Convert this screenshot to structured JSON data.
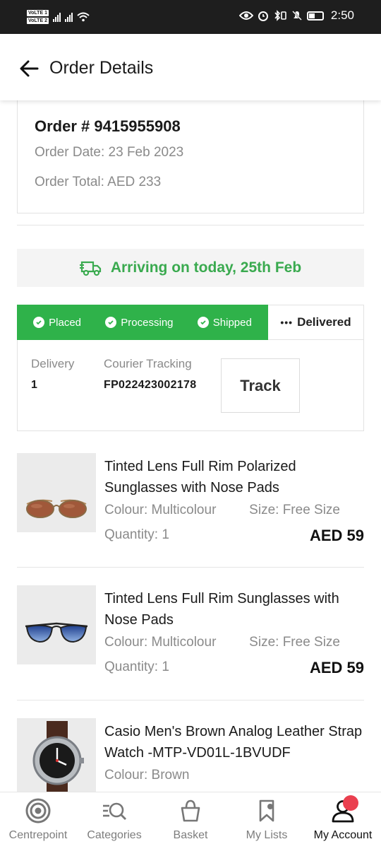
{
  "status_bar": {
    "volte1": "VoLTE 1",
    "volte2": "VoLTE 2",
    "time": "2:50"
  },
  "header": {
    "title": "Order Details"
  },
  "order": {
    "number": "Order # 9415955908",
    "date": "Order Date: 23 Feb 2023",
    "total": "Order Total: AED 233"
  },
  "arrival": {
    "text": "Arriving on today, 25th Feb",
    "color": "#3aaa4f"
  },
  "status_track": {
    "steps_done": [
      "Placed",
      "Processing",
      "Shipped"
    ],
    "step_pending": "Delivered",
    "done_color": "#2fb24a"
  },
  "delivery": {
    "label": "Delivery",
    "value": "1",
    "courier_label": "Courier Tracking",
    "courier_value": "FP022423002178",
    "track_label": "Track"
  },
  "products": [
    {
      "name": "Tinted Lens Full Rim Polarized Sunglasses with Nose Pads",
      "colour": "Colour: Multicolour",
      "size": "Size: Free Size",
      "quantity": "Quantity: 1",
      "price": "AED 59",
      "image": "brown-sunglasses"
    },
    {
      "name": "Tinted Lens Full Rim Sunglasses with Nose Pads",
      "colour": "Colour: Multicolour",
      "size": "Size: Free Size",
      "quantity": "Quantity: 1",
      "price": "AED 59",
      "image": "blue-aviator-sunglasses"
    },
    {
      "name": "Casio Men's Brown Analog Leather Strap Watch -MTP-VD01L-1BVUDF",
      "colour": "Colour: Brown",
      "image": "brown-leather-watch"
    }
  ],
  "bottom_nav": {
    "items": [
      {
        "label": "Centrepoint",
        "icon": "target-icon"
      },
      {
        "label": "Categories",
        "icon": "categories-search-icon"
      },
      {
        "label": "Basket",
        "icon": "basket-icon"
      },
      {
        "label": "My Lists",
        "icon": "bookmark-icon"
      },
      {
        "label": "My Account",
        "icon": "user-icon"
      }
    ],
    "active": "My Account",
    "badge_color": "#ea3f4f"
  }
}
